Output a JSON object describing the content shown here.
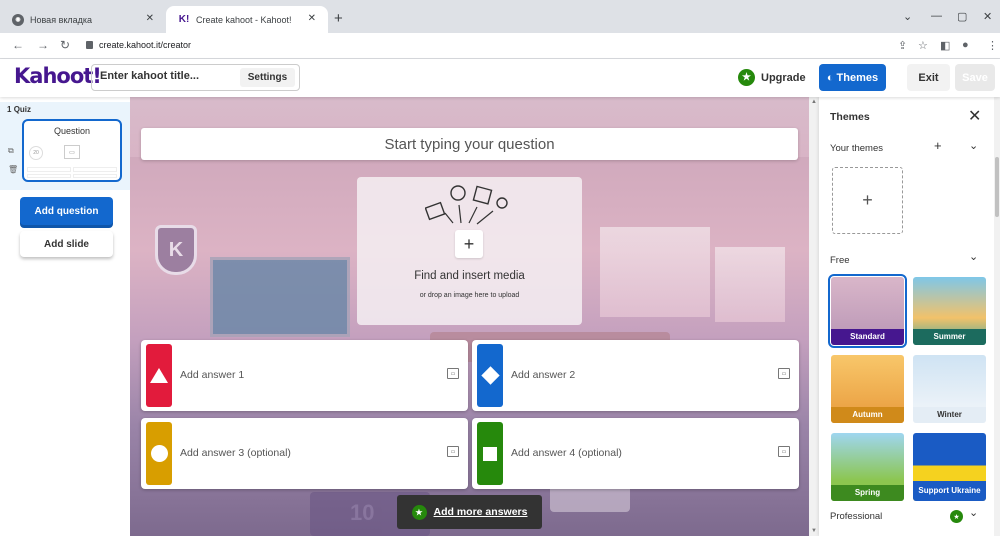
{
  "browser": {
    "tabs": [
      {
        "title": "Новая вкладка",
        "active": false
      },
      {
        "title": "Create kahoot - Kahoot!",
        "active": true
      }
    ],
    "url": "create.kahoot.it/creator"
  },
  "header": {
    "logo": "Kahoot!",
    "title_placeholder": "Enter kahoot title...",
    "settings": "Settings",
    "upgrade": "Upgrade",
    "themes": "Themes",
    "exit": "Exit",
    "save": "Save"
  },
  "sidebar": {
    "slide_number": "1",
    "slide_type": "Quiz",
    "thumb_title": "Question",
    "thumb_timer": "20",
    "add_question": "Add question",
    "add_slide": "Add slide"
  },
  "editor": {
    "question_placeholder": "Start typing your question",
    "media_title": "Find and insert media",
    "media_subtitle": "or drop an image here to upload",
    "answers": [
      {
        "label": "Add answer 1",
        "color": "#e21b3c",
        "shape": "triangle"
      },
      {
        "label": "Add answer 2",
        "color": "#1368ce",
        "shape": "diamond"
      },
      {
        "label": "Add answer 3 (optional)",
        "color": "#d89e00",
        "shape": "circle"
      },
      {
        "label": "Add answer 4 (optional)",
        "color": "#26890c",
        "shape": "square"
      }
    ],
    "add_more": "Add more answers",
    "canvas_shirt_number": "10"
  },
  "themes_panel": {
    "title": "Themes",
    "your_themes": "Your themes",
    "free": "Free",
    "professional": "Professional",
    "themes": [
      {
        "name": "Standard",
        "selected": true,
        "label_color": "#46178f"
      },
      {
        "name": "Summer",
        "selected": false,
        "label_color": "#1c6b5e"
      },
      {
        "name": "Autumn",
        "selected": false,
        "label_color": "#d08a1a"
      },
      {
        "name": "Winter",
        "selected": false,
        "label_color": "#e4edf5"
      },
      {
        "name": "Spring",
        "selected": false,
        "label_color": "#3d8a1f"
      },
      {
        "name": "Support Ukraine",
        "selected": false,
        "label_color": "#1a5bc4"
      }
    ]
  }
}
